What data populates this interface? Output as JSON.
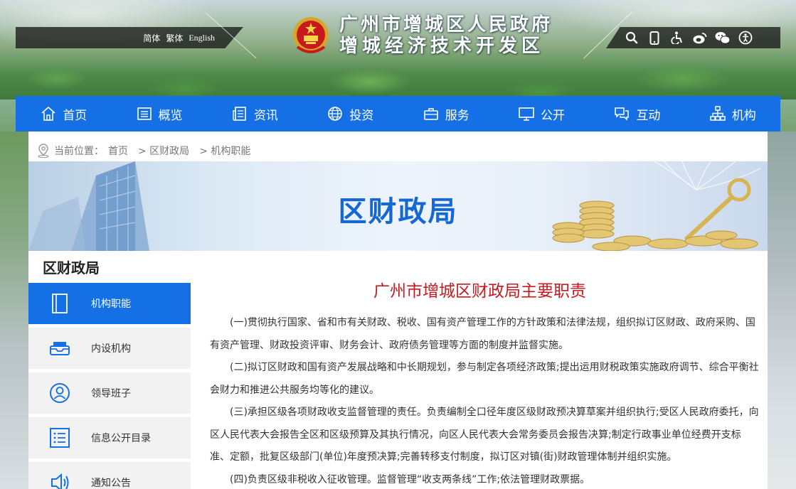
{
  "header": {
    "languages": [
      "简体",
      "繁体",
      "English"
    ],
    "title_line1": "广州市增城区人民政府",
    "title_line2": "增城经济技术开发区",
    "tools": [
      "search-icon",
      "mobile-icon",
      "accessibility-icon",
      "weibo-icon",
      "wechat-icon",
      "elder-mode-icon"
    ]
  },
  "nav": {
    "items": [
      {
        "label": "首页",
        "icon": "home-icon"
      },
      {
        "label": "概览",
        "icon": "overview-icon"
      },
      {
        "label": "资讯",
        "icon": "news-icon"
      },
      {
        "label": "投资",
        "icon": "globe-icon"
      },
      {
        "label": "服务",
        "icon": "briefcase-icon"
      },
      {
        "label": "公开",
        "icon": "monitor-icon"
      },
      {
        "label": "互动",
        "icon": "chat-icon"
      },
      {
        "label": "机构",
        "icon": "org-chart-icon"
      }
    ]
  },
  "breadcrumb": {
    "prefix": "当前位置：",
    "items": [
      "首页",
      "> 区财政局",
      "> 机构职能"
    ]
  },
  "banner": {
    "title": "区财政局"
  },
  "sidebar": {
    "heading": "区财政局",
    "items": [
      {
        "label": "机构职能",
        "icon": "book-icon",
        "active": true
      },
      {
        "label": "内设机构",
        "icon": "inbox-icon",
        "active": false
      },
      {
        "label": "领导班子",
        "icon": "user-icon",
        "active": false
      },
      {
        "label": "信息公开目录",
        "icon": "list-icon",
        "active": false
      },
      {
        "label": "通知公告",
        "icon": "speaker-icon",
        "active": false
      }
    ]
  },
  "article": {
    "title": "广州市增城区财政局主要职责",
    "paragraphs": [
      "(一)贯彻执行国家、省和市有关财政、税收、国有资产管理工作的方针政策和法律法规，组织拟订区财政、政府采购、国有资产管理、财政投资评审、财务会计、政府债务管理等方面的制度并监督实施。",
      "(二)拟订区财政和国有资产发展战略和中长期规划，参与制定各项经济政策;提出运用财税政策实施政府调节、综合平衡社会财力和推进公共服务均等化的建议。",
      "(三)承担区级各项财政收支监督管理的责任。负责编制全口径年度区级财政预决算草案并组织执行;受区人民政府委托，向区人民代表大会报告全区和区级预算及其执行情况，向区人民代表大会常务委员会报告决算;制定行政事业单位经费开支标准、定额，批复区级部门(单位)年度预决算;完善转移支付制度，拟订区对镇(街)财政管理体制并组织实施。",
      "(四)负责区级非税收入征收管理。监督管理“收支两条线”工作;依法管理财政票据。"
    ]
  },
  "colors": {
    "primary": "#1570e6",
    "title_red": "#c8191e"
  }
}
